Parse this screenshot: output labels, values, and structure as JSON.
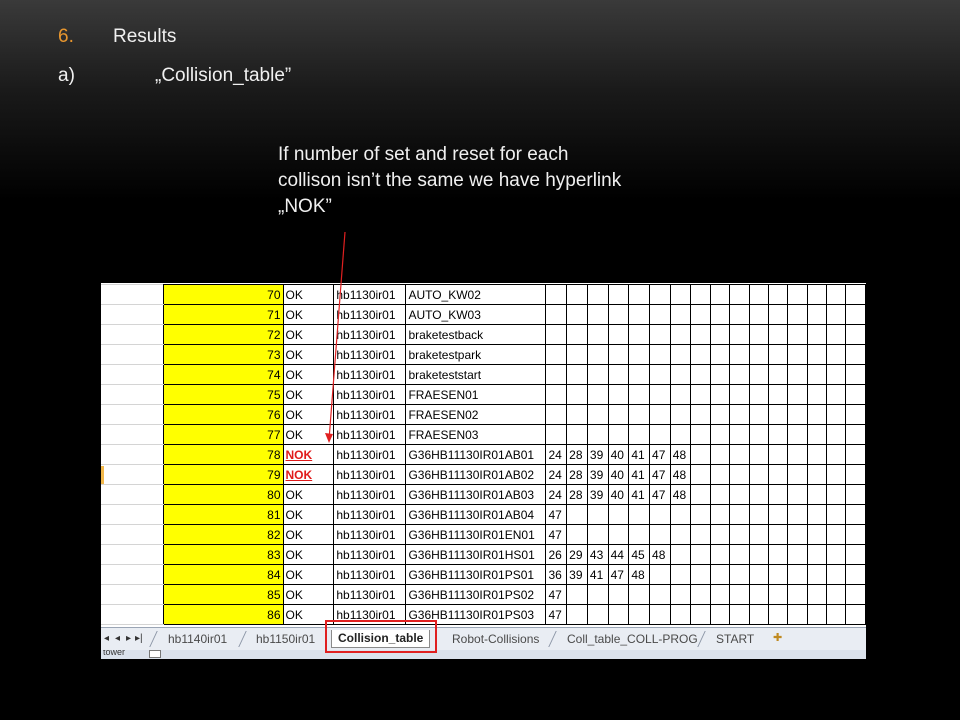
{
  "heading": {
    "number": "6.",
    "text": "Results"
  },
  "subheading": {
    "letter": "a)",
    "text": "„Collision_table”"
  },
  "annotation": {
    "lines": [
      "If number of set and reset for each",
      "collison isn’t the same we have hyperlink",
      "„NOK”"
    ]
  },
  "colors": {
    "accent": "#e8962e",
    "highlight_yellow": "#ffff00",
    "nok_red": "#e01b1b",
    "frame_red": "#e02020"
  },
  "table": {
    "rows": [
      {
        "num": "70",
        "status": "OK",
        "robot": "hb1130ir01",
        "name": "AUTO_KW02",
        "values": []
      },
      {
        "num": "71",
        "status": "OK",
        "robot": "hb1130ir01",
        "name": "AUTO_KW03",
        "values": []
      },
      {
        "num": "72",
        "status": "OK",
        "robot": "hb1130ir01",
        "name": "braketestback",
        "values": []
      },
      {
        "num": "73",
        "status": "OK",
        "robot": "hb1130ir01",
        "name": "braketestpark",
        "values": []
      },
      {
        "num": "74",
        "status": "OK",
        "robot": "hb1130ir01",
        "name": "braketeststart",
        "values": []
      },
      {
        "num": "75",
        "status": "OK",
        "robot": "hb1130ir01",
        "name": "FRAESEN01",
        "values": []
      },
      {
        "num": "76",
        "status": "OK",
        "robot": "hb1130ir01",
        "name": "FRAESEN02",
        "values": []
      },
      {
        "num": "77",
        "status": "OK",
        "robot": "hb1130ir01",
        "name": "FRAESEN03",
        "values": []
      },
      {
        "num": "78",
        "status": "NOK",
        "robot": "hb1130ir01",
        "name": "G36HB11130IR01AB01",
        "values": [
          "24",
          "28",
          "39",
          "40",
          "41",
          "47",
          "48"
        ]
      },
      {
        "num": "79",
        "status": "NOK",
        "robot": "hb1130ir01",
        "name": "G36HB11130IR01AB02",
        "values": [
          "24",
          "28",
          "39",
          "40",
          "41",
          "47",
          "48"
        ]
      },
      {
        "num": "80",
        "status": "OK",
        "robot": "hb1130ir01",
        "name": "G36HB11130IR01AB03",
        "values": [
          "24",
          "28",
          "39",
          "40",
          "41",
          "47",
          "48"
        ]
      },
      {
        "num": "81",
        "status": "OK",
        "robot": "hb1130ir01",
        "name": "G36HB11130IR01AB04",
        "values": [
          "47"
        ]
      },
      {
        "num": "82",
        "status": "OK",
        "robot": "hb1130ir01",
        "name": "G36HB11130IR01EN01",
        "values": [
          "47"
        ]
      },
      {
        "num": "83",
        "status": "OK",
        "robot": "hb1130ir01",
        "name": "G36HB11130IR01HS01",
        "values": [
          "26",
          "29",
          "43",
          "44",
          "45",
          "48"
        ]
      },
      {
        "num": "84",
        "status": "OK",
        "robot": "hb1130ir01",
        "name": "G36HB11130IR01PS01",
        "values": [
          "36",
          "39",
          "41",
          "47",
          "48"
        ]
      },
      {
        "num": "85",
        "status": "OK",
        "robot": "hb1130ir01",
        "name": "G36HB11130IR01PS02",
        "values": [
          "47"
        ]
      },
      {
        "num": "86",
        "status": "OK",
        "robot": "hb1130ir01",
        "name": "G36HB11130IR01PS03",
        "values": [
          "47"
        ]
      }
    ]
  },
  "tabs": {
    "nav_icons": [
      "first-sheet-icon",
      "prev-sheet-icon",
      "next-sheet-icon",
      "last-sheet-icon"
    ],
    "items": [
      {
        "label": "hb1140ir01",
        "active": false
      },
      {
        "label": "hb1150ir01",
        "active": false
      },
      {
        "label": "Collision_table",
        "active": true
      },
      {
        "label": "Robot-Collisions",
        "active": false
      },
      {
        "label": "Coll_table_COLL-PROG",
        "active": false
      },
      {
        "label": "START",
        "active": false
      }
    ]
  },
  "statusbar": {
    "text": "tower"
  }
}
